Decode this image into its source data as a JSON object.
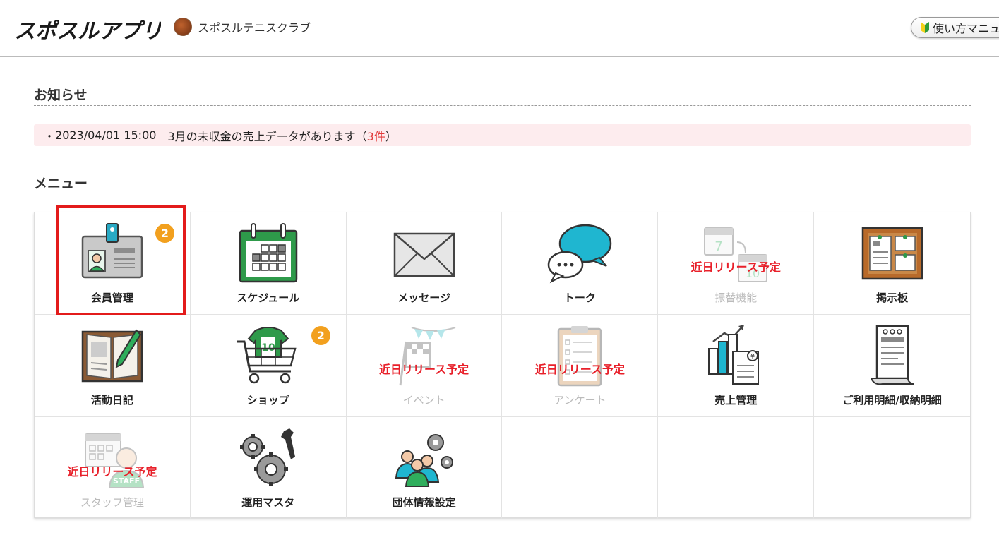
{
  "header": {
    "logo_text": "スポスルアプリ",
    "club_name": "スポスルテニスクラブ",
    "manual_button": "使い方マニュアル"
  },
  "notices": {
    "title": "お知らせ",
    "items": [
      {
        "prefix": "・",
        "datetime": "2023/04/01 15:00",
        "message": "3月の未収金の売上データがあります",
        "open": "（",
        "count": "3件",
        "close": "）"
      }
    ]
  },
  "menu": {
    "title": "メニュー",
    "soon_label": "近日リリース予定",
    "items": [
      {
        "label": "会員管理",
        "icon": "member-card-icon",
        "badge": "2",
        "enabled": true
      },
      {
        "label": "スケジュール",
        "icon": "calendar-icon",
        "enabled": true
      },
      {
        "label": "メッセージ",
        "icon": "envelope-icon",
        "enabled": true
      },
      {
        "label": "トーク",
        "icon": "chat-bubbles-icon",
        "enabled": true
      },
      {
        "label": "振替機能",
        "icon": "transfer-calendar-icon",
        "enabled": false
      },
      {
        "label": "掲示板",
        "icon": "bulletin-board-icon",
        "enabled": true
      },
      {
        "label": "活動日記",
        "icon": "diary-icon",
        "enabled": true
      },
      {
        "label": "ショップ",
        "icon": "shopping-cart-icon",
        "badge": "2",
        "enabled": true
      },
      {
        "label": "イベント",
        "icon": "event-flag-icon",
        "enabled": false
      },
      {
        "label": "アンケート",
        "icon": "survey-clipboard-icon",
        "enabled": false
      },
      {
        "label": "売上管理",
        "icon": "sales-chart-icon",
        "enabled": true
      },
      {
        "label": "ご利用明細/収納明細",
        "icon": "receipt-icon",
        "enabled": true
      },
      {
        "label": "スタッフ管理",
        "icon": "staff-icon",
        "enabled": false
      },
      {
        "label": "運用マスタ",
        "icon": "gears-wrench-icon",
        "enabled": true
      },
      {
        "label": "団体情報設定",
        "icon": "group-settings-icon",
        "enabled": true
      }
    ]
  },
  "colors": {
    "accent_badge": "#f2a01e",
    "soon_text": "#e8202a",
    "highlight_border": "#e31b1b",
    "notice_bg": "#fdecee"
  }
}
